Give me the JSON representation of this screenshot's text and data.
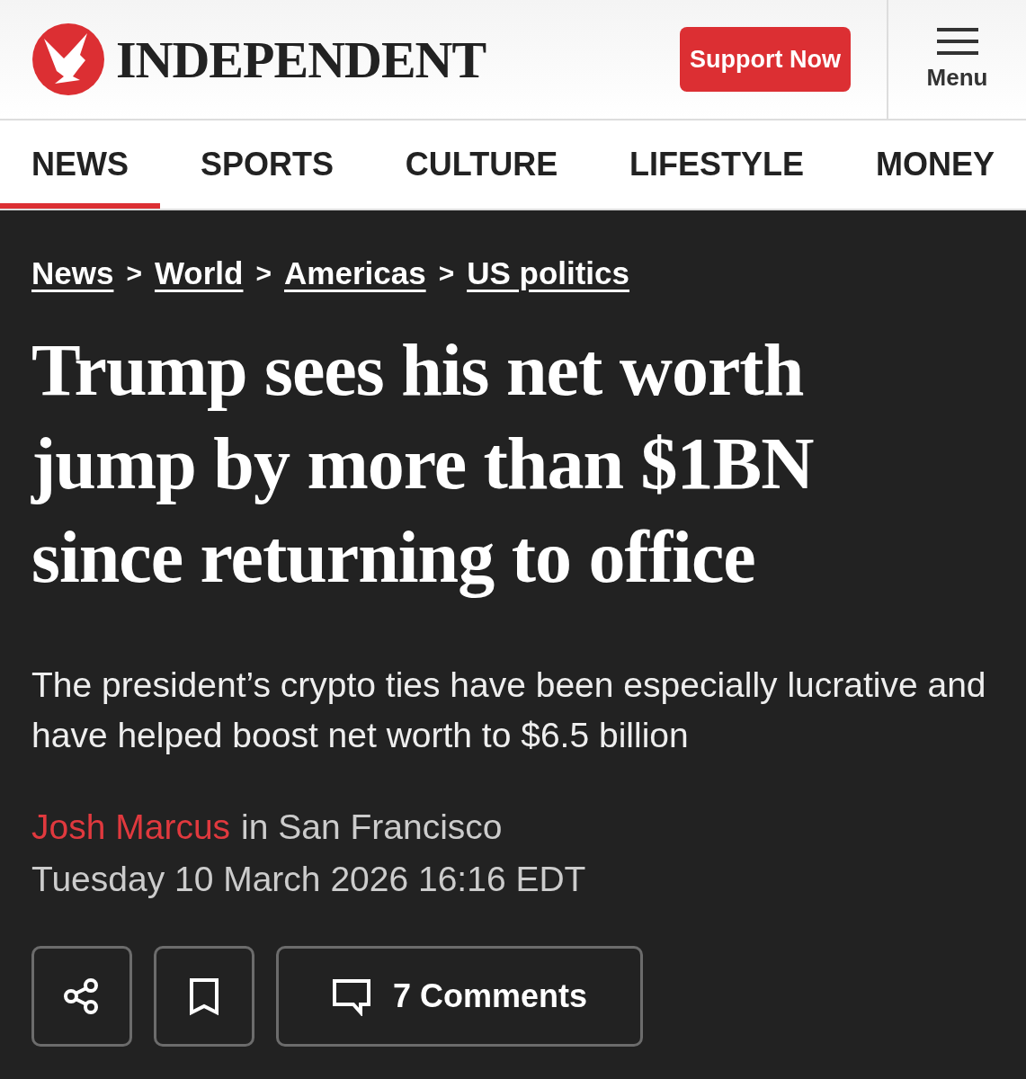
{
  "header": {
    "logo_text": "INDEPENDENT",
    "support_button": "Support Now",
    "menu_label": "Menu"
  },
  "nav_tabs": [
    {
      "label": "NEWS",
      "selected": true
    },
    {
      "label": "SPORTS",
      "selected": false
    },
    {
      "label": "CULTURE",
      "selected": false
    },
    {
      "label": "LIFESTYLE",
      "selected": false
    },
    {
      "label": "MONEY",
      "selected": false
    }
  ],
  "breadcrumbs": [
    {
      "label": "News",
      "separator": ">"
    },
    {
      "label": "World",
      "separator": ">"
    },
    {
      "label": "Americas",
      "separator": ">"
    },
    {
      "label": "US politics"
    }
  ],
  "article": {
    "headline": "Trump sees his net worth jump by more than $1BN since returning to office",
    "standfirst": "The president’s crypto ties have been especially lucrative and have helped boost net worth to $6.5 billion",
    "author": "Josh Marcus",
    "location": "in San Francisco",
    "date": "Tuesday 10 March 2026 16:16 EDT"
  },
  "actions": [
    {
      "kind": "share"
    },
    {
      "kind": "bookmark"
    },
    {
      "kind": "comments",
      "label": "7 Comments"
    }
  ]
}
